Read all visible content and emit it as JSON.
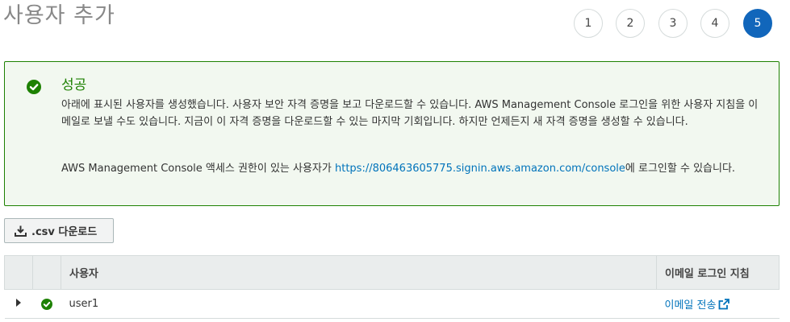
{
  "page": {
    "title": "사용자 추가"
  },
  "stepper": {
    "steps": [
      "1",
      "2",
      "3",
      "4",
      "5"
    ],
    "active": "5"
  },
  "success": {
    "heading": "성공",
    "message": "아래에 표시된 사용자를 생성했습니다. 사용자 보안 자격 증명을 보고 다운로드할 수 있습니다. AWS Management Console 로그인을 위한 사용자 지침을 이메일로 보낼 수도 있습니다. 지금이 이 자격 증명을 다운로드할 수 있는 마지막 기회입니다. 하지만 언제든지 새 자격 증명을 생성할 수 있습니다.",
    "console_prefix": "AWS Management Console 액세스 권한이 있는 사용자가 ",
    "console_url": "https://806463605775.signin.aws.amazon.com/console",
    "console_suffix": "에 로그인할 수 있습니다."
  },
  "actions": {
    "download_csv": ".csv 다운로드"
  },
  "table": {
    "headers": {
      "user": "사용자",
      "email_instructions": "이메일 로그인 지침"
    },
    "rows": [
      {
        "user": "user1",
        "email_action": "이메일 전송"
      }
    ]
  },
  "colors": {
    "success_green": "#1d8102",
    "success_bg": "#f2f8f0",
    "link_blue": "#0073bb",
    "step_active": "#1166bb"
  },
  "icons": {
    "success": "check-circle-icon",
    "download": "download-icon",
    "expand": "caret-right-icon",
    "external": "external-link-icon"
  }
}
